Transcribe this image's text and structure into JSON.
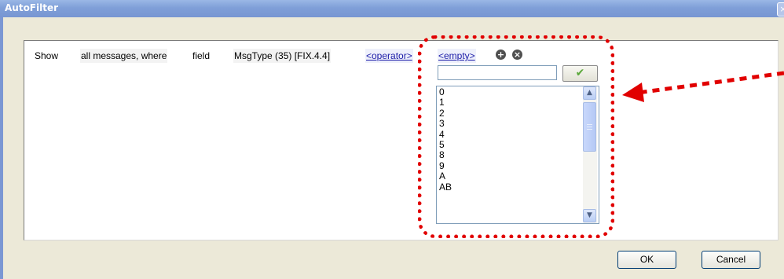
{
  "window": {
    "title": "AutoFilter",
    "close_label": "×"
  },
  "filter": {
    "show": "Show",
    "scope": "all messages, where",
    "field_label": "field",
    "field_value": "MsgType (35) [FIX.4.4]",
    "operator": "<operator>",
    "value": "<empty>",
    "add_label": "+",
    "remove_label": "×"
  },
  "value_input": {
    "value": "",
    "placeholder": ""
  },
  "values_list": [
    "0",
    "1",
    "2",
    "3",
    "4",
    "5",
    "8",
    "9",
    "A",
    "AB"
  ],
  "buttons": {
    "ok": "OK",
    "cancel": "Cancel"
  },
  "colors": {
    "annotation": "#e10000",
    "title_bar": "#7f9fd8",
    "dialog_bg": "#ECE9D8"
  }
}
